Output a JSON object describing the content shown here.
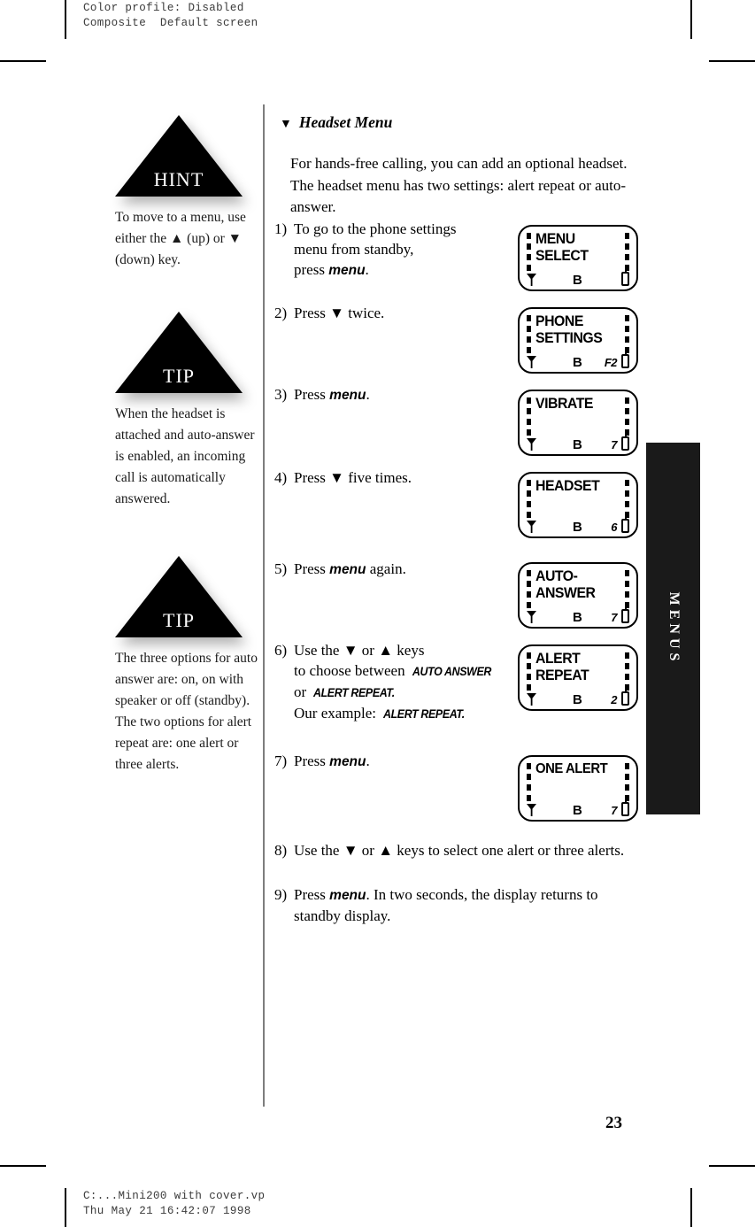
{
  "prepress": {
    "header_line1": "Color profile: Disabled",
    "header_line2": "Composite  Default screen",
    "footer_line1": "C:...Mini200 with cover.vp",
    "footer_line2": "Thu May 21 16:42:07 1998"
  },
  "sidebar": {
    "blocks": [
      {
        "badge": "HINT",
        "text": "To move to a menu, use either the ▲ (up) or ▼ (down) key."
      },
      {
        "badge": "TIP",
        "text": "When the headset is attached and auto-answer is enabled, an incoming call is automatically answered."
      },
      {
        "badge": "TIP",
        "text": "The three options for auto answer are: on, on with speaker or off (standby). The two options for alert repeat are: one alert or three alerts."
      }
    ]
  },
  "main": {
    "section_bullet": "▼",
    "section_title": "Headset Menu",
    "intro": "For hands-free calling, you can add an optional headset. The headset menu has two settings: alert repeat or auto-answer.",
    "steps": [
      {
        "num": "1)",
        "text": "To go to the phone settings menu from standby, press menu."
      },
      {
        "num": "2)",
        "text": "Press ▼ twice."
      },
      {
        "num": "3)",
        "text": "Press menu."
      },
      {
        "num": "4)",
        "text": "Press ▼ five times."
      },
      {
        "num": "5)",
        "text": "Press menu again."
      },
      {
        "num": "6)",
        "text": "Use the ▼ or ▲ keys to choose between AUTO ANSWER or ALERT REPEAT. Our example: ALERT REPEAT."
      },
      {
        "num": "7)",
        "text": "Press menu."
      },
      {
        "num": "8)",
        "text": "Use the ▼ or ▲ keys to select one alert or three alerts."
      },
      {
        "num": "9)",
        "text": "Press menu. In two seconds, the display returns to standby display."
      }
    ]
  },
  "lcd_screens": [
    {
      "text": "MENU\nSELECT",
      "signal": "B",
      "indicator": ""
    },
    {
      "text": "PHONE\nSETTINGS",
      "signal": "B",
      "indicator": "F2"
    },
    {
      "text": "VIBRATE",
      "signal": "B",
      "indicator": "7"
    },
    {
      "text": "HEADSET",
      "signal": "B",
      "indicator": "6"
    },
    {
      "text": "AUTO-\nANSWER",
      "signal": "B",
      "indicator": "7"
    },
    {
      "text": "ALERT\nREPEAT",
      "signal": "B",
      "indicator": "2"
    },
    {
      "text": "ONE ALERT",
      "signal": "B",
      "indicator": "7"
    }
  ],
  "thumb_tab": {
    "label": "MENUS"
  },
  "page_number": "23"
}
